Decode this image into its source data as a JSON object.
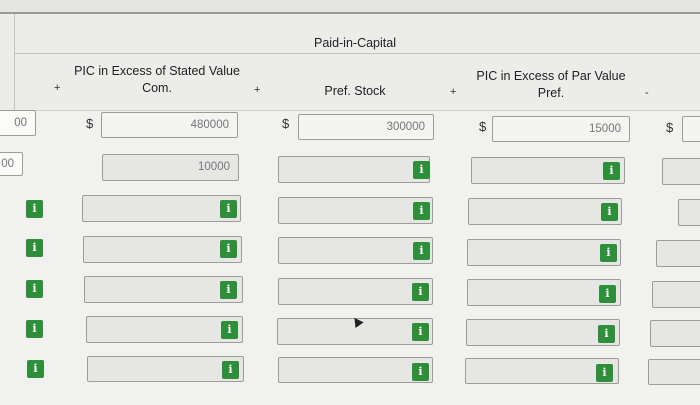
{
  "header": {
    "group_title": "Paid-in-Capital",
    "columns": [
      {
        "label_line1": "PIC in Excess of Stated Value",
        "label_line2": "Com."
      },
      {
        "label_line1": "Pref. Stock",
        "label_line2": ""
      },
      {
        "label_line1": "PIC in Excess of Par Value",
        "label_line2": "Pref."
      }
    ],
    "operator": "+",
    "operator_last": "-"
  },
  "currency_symbol": "$",
  "row1": {
    "left_stub_value": "00",
    "values": [
      "480000",
      "300000",
      "15000"
    ]
  },
  "row2": {
    "left_stub_value": "00",
    "values": [
      "10000",
      "",
      ""
    ]
  },
  "info_glyph": "i",
  "icons": {
    "info": "info-icon",
    "cursor": "mouse-cursor-icon"
  },
  "colors": {
    "info_green": "#2f8e3a",
    "field_border": "#9c9c9a",
    "background": "#f1f1ef"
  }
}
